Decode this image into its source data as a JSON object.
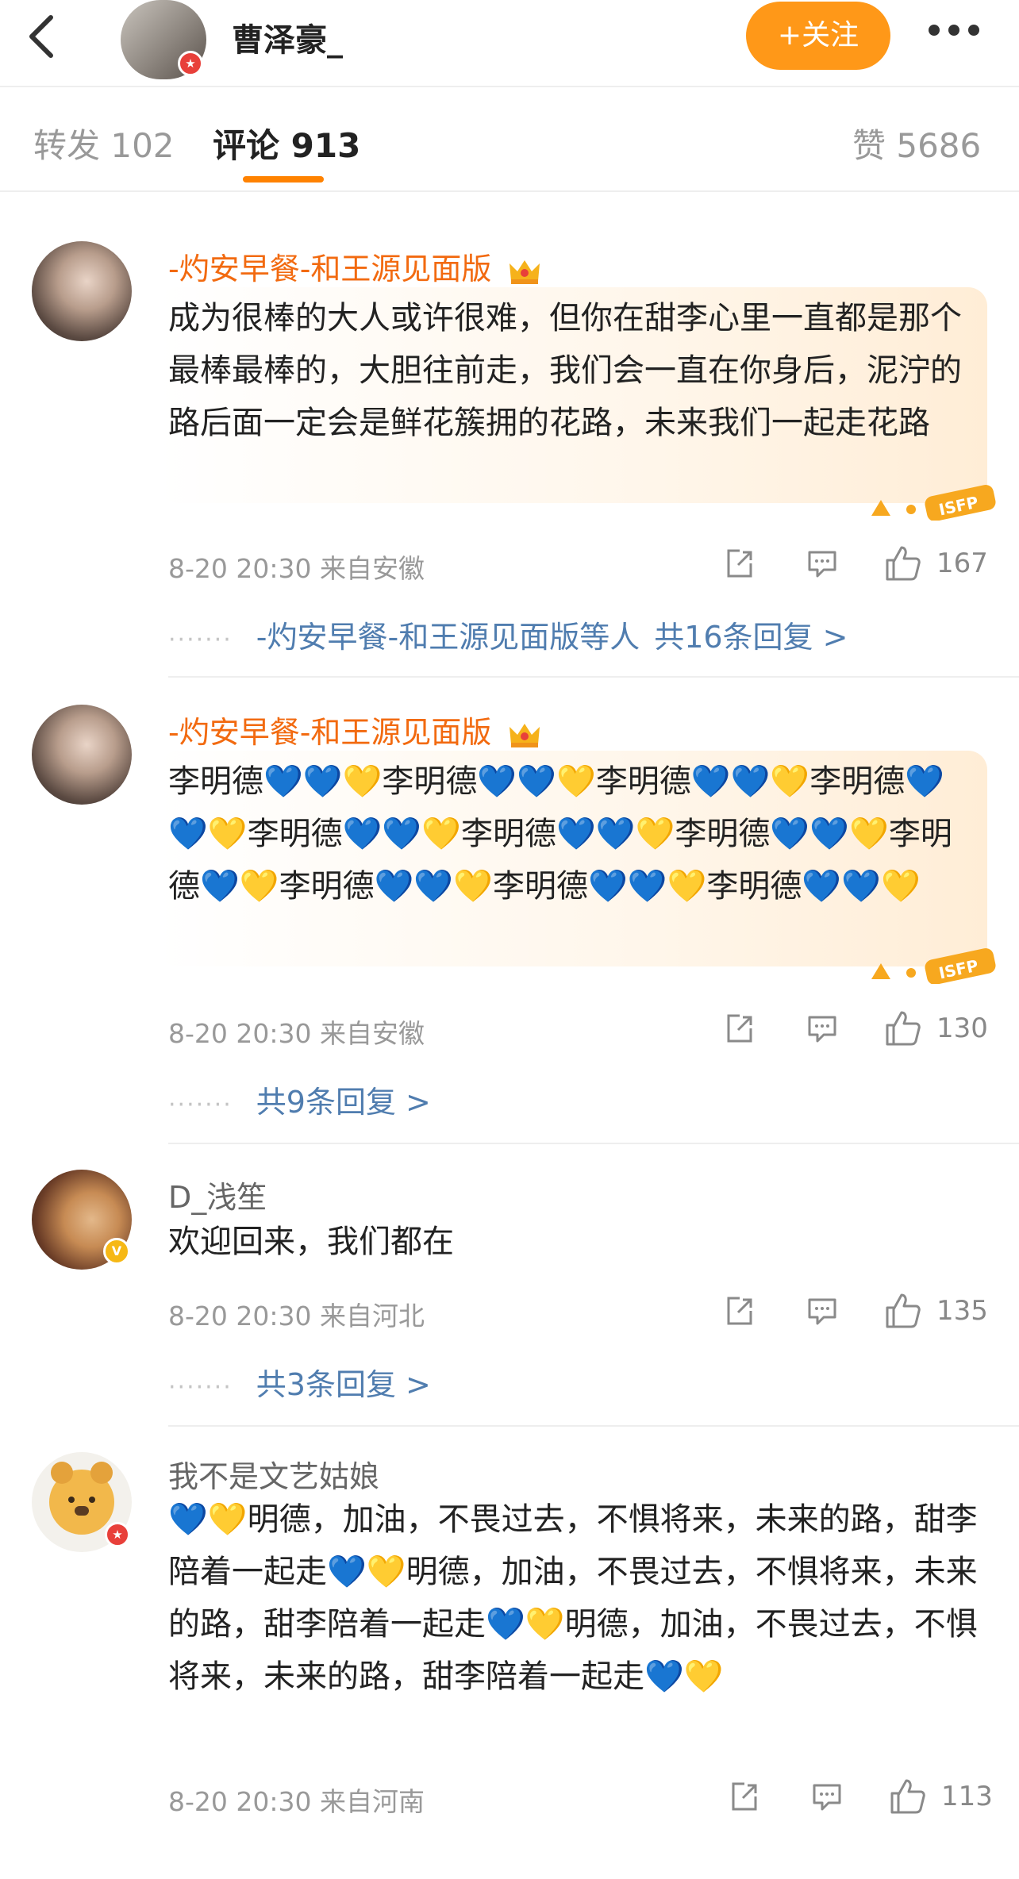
{
  "header": {
    "profile_name": "曹泽豪_",
    "follow_label": "+关注"
  },
  "tabs": [
    {
      "label": "转发 102"
    },
    {
      "label": "评论 913"
    },
    {
      "label": "赞 5686"
    }
  ],
  "colors": {
    "accent": "#ff8200",
    "vip_name": "#f26a10",
    "link": "#507daf"
  },
  "comments": [
    {
      "author": "-灼安早餐-和王源见面版",
      "text": "成为很棒的大人或许很难，但你在甜李心里一直都是那个最棒最棒的，大胆往前走，我们会一直在你身后，泥泞的路后面一定会是鲜花簇拥的花路，未来我们一起走花路",
      "time_location": "8-20 20:30 来自安徽",
      "likes": "167",
      "replies_by": "-灼安早餐-和王源见面版等人",
      "replies_count": "共16条回复 >"
    },
    {
      "author": "-灼安早餐-和王源见面版",
      "text": "李明德💙💙💛李明德💙💙💛李明德💙💙💛李明德💙💙💛李明德💙💙💛李明德💙💙💛李明德💙💙💛李明德💙💛李明德💙💙💛李明德💙💙💛李明德💙💙💛",
      "time_location": "8-20 20:30 来自安徽",
      "likes": "130",
      "replies_count": "共9条回复 >"
    },
    {
      "author": "D_浅笙",
      "text": "欢迎回来，我们都在",
      "time_location": "8-20 20:30 来自河北",
      "likes": "135",
      "replies_count": "共3条回复 >"
    },
    {
      "author": "我不是文艺姑娘",
      "text": "💙💛明德，加油，不畏过去，不惧将来，未来的路，甜李陪着一起走💙💛明德，加油，不畏过去，不惧将来，未来的路，甜李陪着一起走💙💛明德，加油，不畏过去，不惧将来，未来的路，甜李陪着一起走💙💛",
      "time_location": "8-20 20:30 来自河南",
      "likes": "113"
    }
  ]
}
